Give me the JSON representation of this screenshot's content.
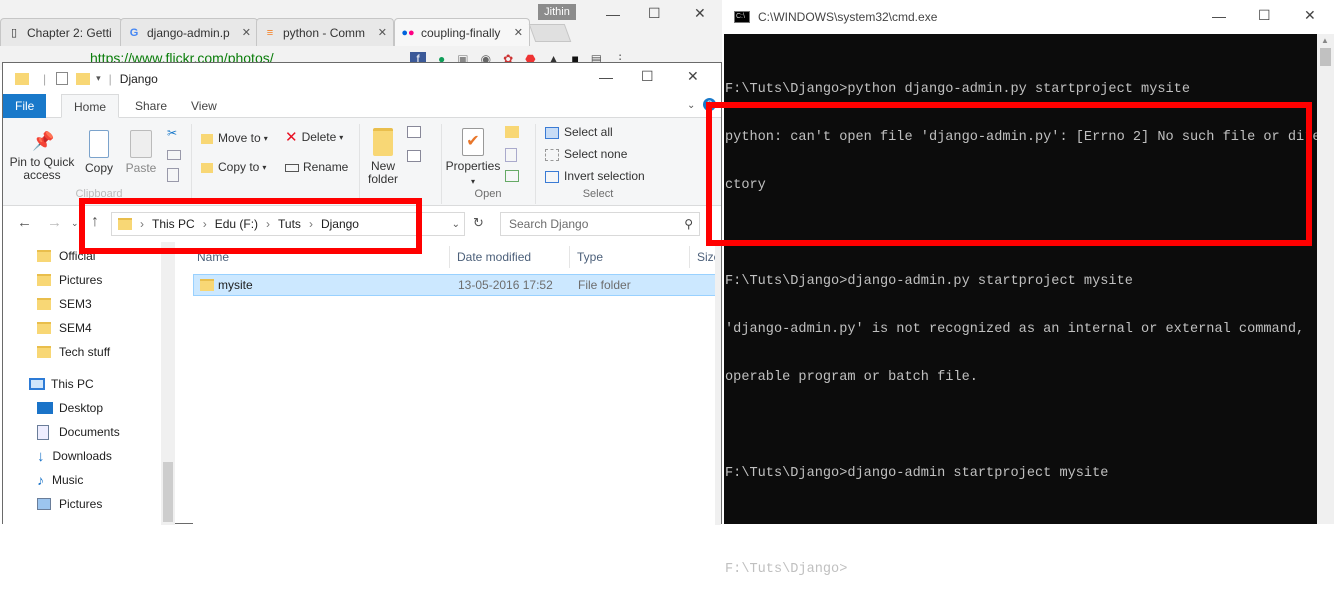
{
  "browser": {
    "tabs": [
      {
        "label": "Chapter 2: Getti",
        "icon": "page-icon"
      },
      {
        "label": "django-admin.p",
        "icon": "google-icon"
      },
      {
        "label": "python - Comm",
        "icon": "stackoverflow-icon"
      },
      {
        "label": "coupling-finally",
        "icon": "flickr-icon"
      }
    ],
    "user": "Jithin",
    "url": "https://www.flickr.com/photos/"
  },
  "explorer": {
    "title": "Django",
    "ribbon_tabs": [
      "File",
      "Home",
      "Share",
      "View"
    ],
    "buttons": {
      "pin": "Pin to Quick access",
      "copy": "Copy",
      "paste": "Paste",
      "move_to": "Move to",
      "copy_to": "Copy to",
      "delete": "Delete",
      "rename": "Rename",
      "new_folder": "New folder",
      "properties": "Properties",
      "select_all": "Select all",
      "select_none": "Select none",
      "invert_selection": "Invert selection"
    },
    "groups": {
      "open": "Open",
      "select": "Select"
    },
    "breadcrumb": [
      "This PC",
      "Edu (F:)",
      "Tuts",
      "Django"
    ],
    "search_placeholder": "Search Django",
    "nav_items": [
      {
        "label": "Official",
        "icon": "folder-icon"
      },
      {
        "label": "Pictures",
        "icon": "folder-icon"
      },
      {
        "label": "SEM3",
        "icon": "folder-icon"
      },
      {
        "label": "SEM4",
        "icon": "folder-icon"
      },
      {
        "label": "Tech stuff",
        "icon": "folder-icon"
      },
      {
        "label": "This PC",
        "icon": "computer-icon"
      },
      {
        "label": "Desktop",
        "icon": "desktop-icon"
      },
      {
        "label": "Documents",
        "icon": "documents-icon"
      },
      {
        "label": "Downloads",
        "icon": "downloads-icon"
      },
      {
        "label": "Music",
        "icon": "music-icon"
      },
      {
        "label": "Pictures",
        "icon": "pictures-icon"
      }
    ],
    "columns": [
      "Name",
      "Date modified",
      "Type",
      "Size"
    ],
    "files": [
      {
        "name": "mysite",
        "date": "13-05-2016 17:52",
        "type": "File folder"
      }
    ]
  },
  "cmd": {
    "title": "C:\\WINDOWS\\system32\\cmd.exe",
    "lines": [
      "F:\\Tuts\\Django>python django-admin.py startproject mysite",
      "python: can't open file 'django-admin.py': [Errno 2] No such file or dire",
      "ctory",
      "",
      "F:\\Tuts\\Django>django-admin.py startproject mysite",
      "'django-admin.py' is not recognized as an internal or external command,",
      "operable program or batch file.",
      "",
      "F:\\Tuts\\Django>django-admin startproject mysite",
      "",
      "F:\\Tuts\\Django>"
    ]
  },
  "colors": {
    "highlight": "#ff0000",
    "ribbon_file": "#1979ca",
    "selection": "#cce8ff"
  }
}
